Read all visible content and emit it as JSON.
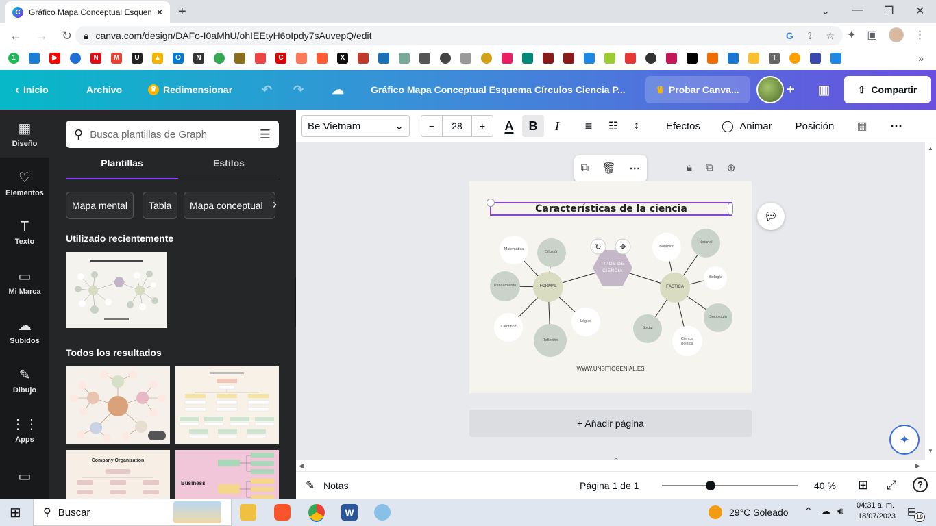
{
  "browser": {
    "tab_title": "Gráfico Mapa Conceptual Esquem",
    "url": "canva.com/design/DAFo-I0aMhU/ohIEEtyH6oIpdy7sAuvepQ/edit"
  },
  "header": {
    "inicio": "Inicio",
    "archivo": "Archivo",
    "redimensionar": "Redimensionar",
    "doc_title": "Gráfico Mapa Conceptual Esquema Círculos Ciencia P...",
    "probar": "Probar Canva...",
    "compartir": "Compartir"
  },
  "rail": [
    {
      "label": "Diseño",
      "icon": "layout-icon",
      "glyph": "▦"
    },
    {
      "label": "Elementos",
      "icon": "elements-icon",
      "glyph": "♡"
    },
    {
      "label": "Texto",
      "icon": "text-icon",
      "glyph": "T"
    },
    {
      "label": "Mi Marca",
      "icon": "brand-icon",
      "glyph": "▭"
    },
    {
      "label": "Subidos",
      "icon": "upload-icon",
      "glyph": "☁"
    },
    {
      "label": "Dibujo",
      "icon": "draw-icon",
      "glyph": "✎"
    },
    {
      "label": "Apps",
      "icon": "apps-icon",
      "glyph": "⋮⋮"
    }
  ],
  "panel": {
    "search_placeholder": "Busca plantillas de Graph",
    "tab_templates": "Plantillas",
    "tab_styles": "Estilos",
    "chips": [
      "Mapa mental",
      "Tabla",
      "Mapa conceptual"
    ],
    "recent_heading": "Utilizado recientemente",
    "all_heading": "Todos los resultados",
    "thumb_org_title": "Company Organization",
    "thumb_business": "Business"
  },
  "toolbar": {
    "font": "Be Vietnam",
    "font_size": "28",
    "minus": "−",
    "plus": "+",
    "efectos": "Efectos",
    "animar": "Animar",
    "posicion": "Posición"
  },
  "design": {
    "title": "Características de la ciencia",
    "center": "TIPOS DE CIENCIA",
    "formal": "FORMAL",
    "factica": "FÁCTICA",
    "formal_children": [
      "Matemática",
      "Difusión",
      "Pensamiento",
      "Científico",
      "Reflexión",
      "Lógico"
    ],
    "factica_children": [
      "Botánico",
      "Notarial",
      "Biología",
      "Sociología",
      "Ciencia política",
      "Social"
    ],
    "footer": "WWW.UNSITIOGENIAL.ES"
  },
  "canvas": {
    "add_page": "+ Añadir página"
  },
  "footer": {
    "notas": "Notas",
    "pagina": "Página 1 de 1",
    "zoom": "40 %"
  },
  "taskbar": {
    "search": "Buscar",
    "weather": "29°C  Soleado",
    "time": "04:31 a. m.",
    "date": "18/07/2023",
    "notif": "19"
  }
}
